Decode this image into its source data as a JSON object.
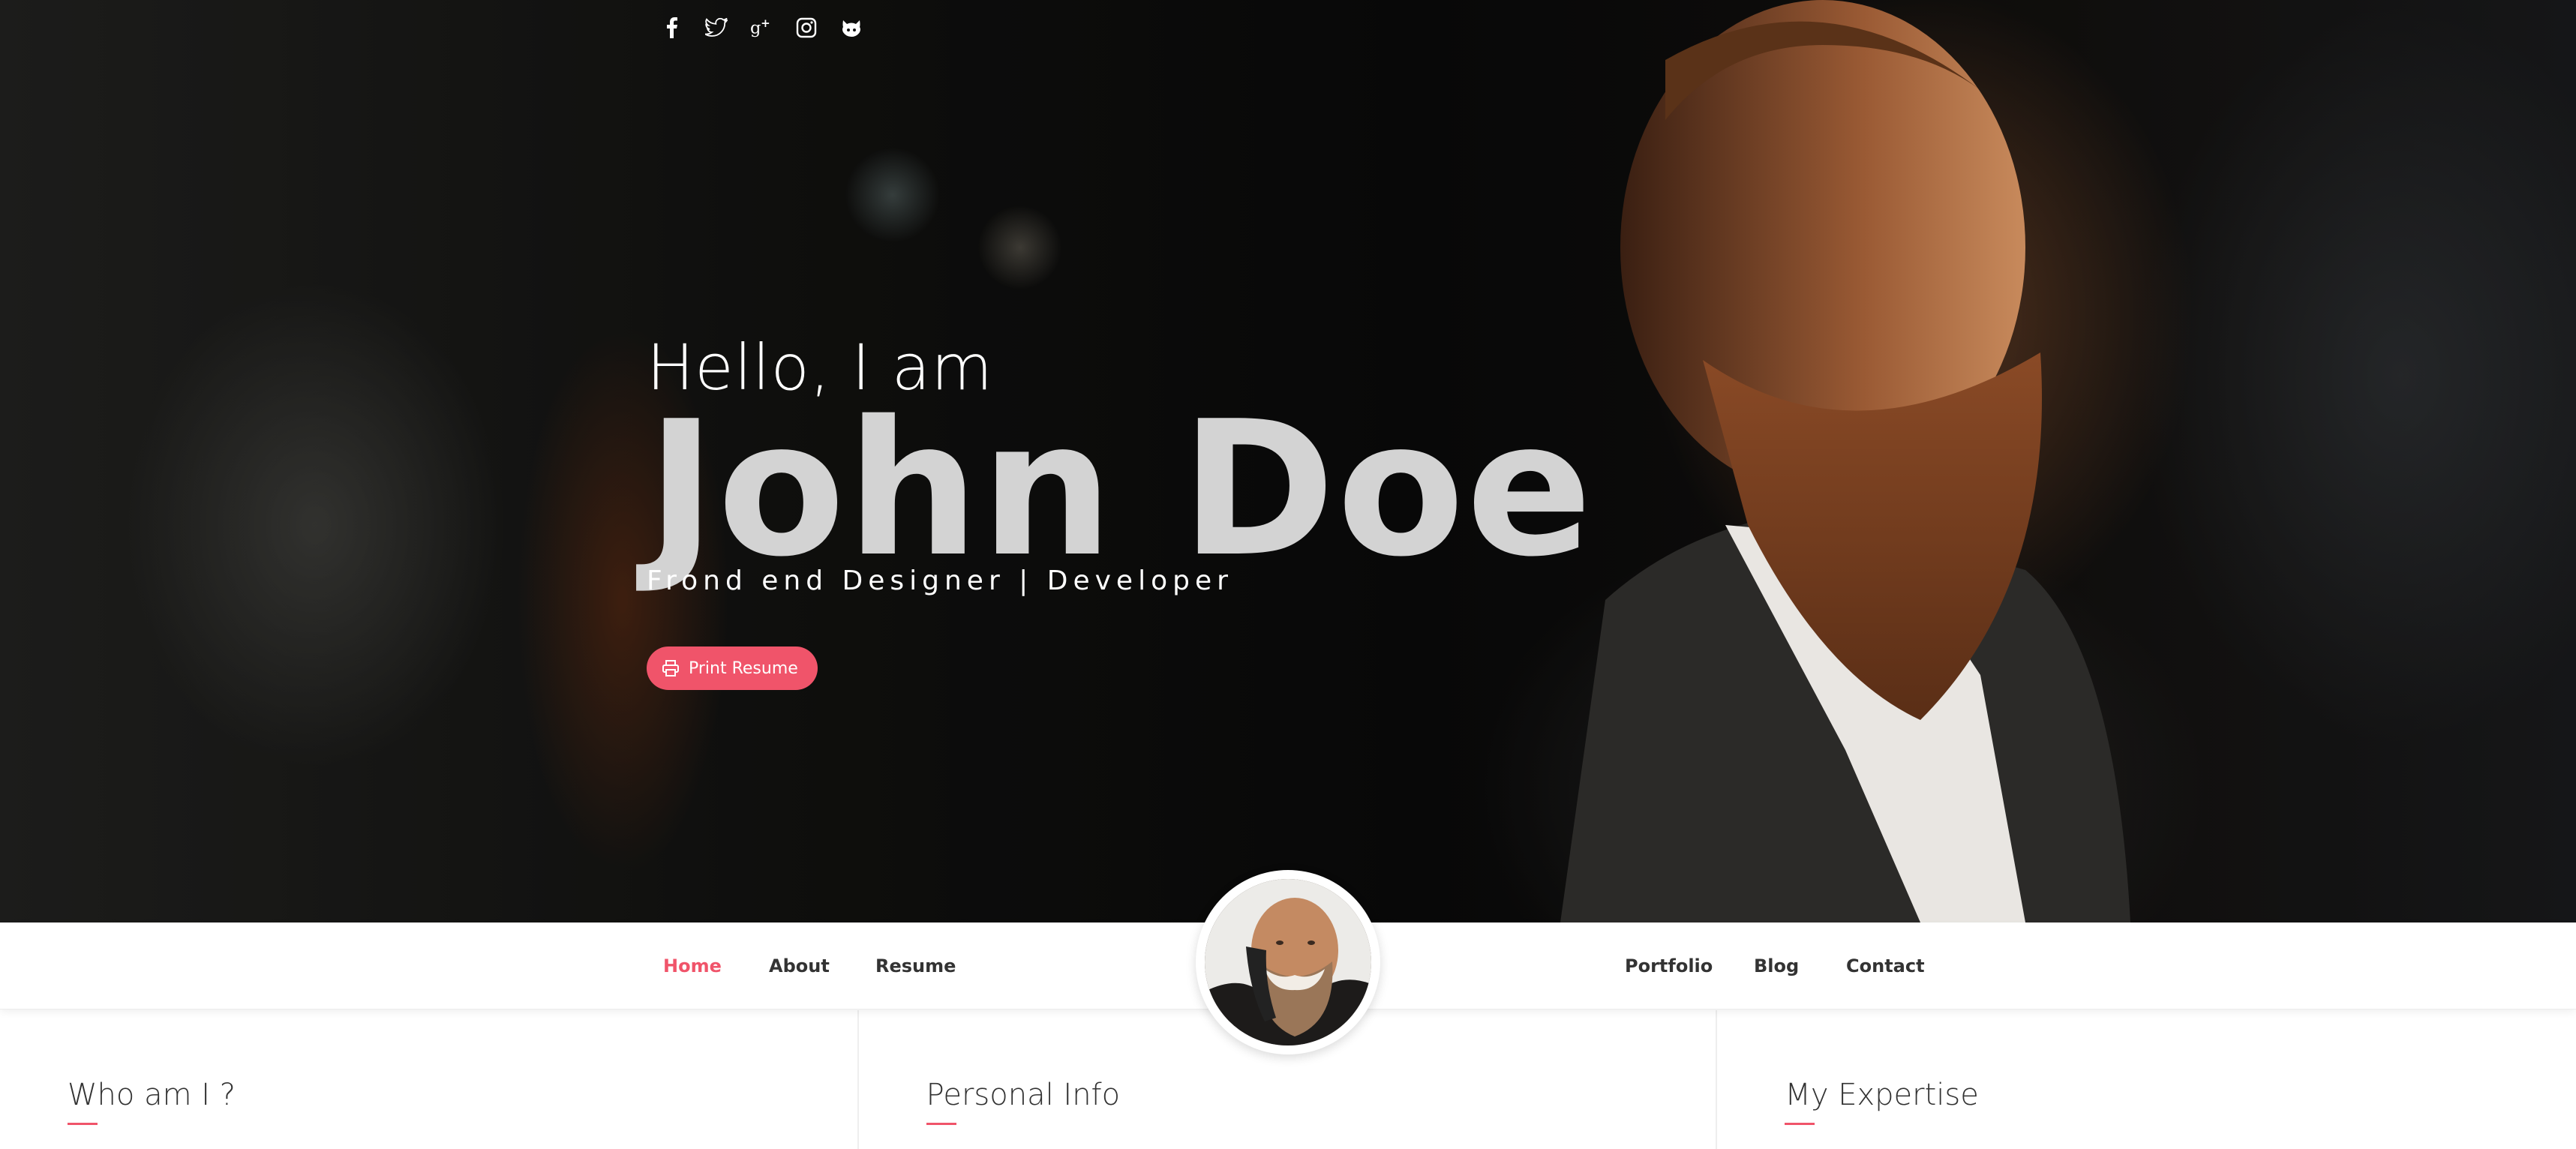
{
  "hero": {
    "greeting": "Hello, I am",
    "name": "John Doe",
    "role": "Frond end Designer | Developer",
    "print_button_label": "Print Resume"
  },
  "social_icons": [
    "facebook-icon",
    "twitter-icon",
    "google-plus-icon",
    "instagram-icon",
    "github-icon"
  ],
  "nav": {
    "left": [
      "Home",
      "About",
      "Resume"
    ],
    "right": [
      "Portfolio",
      "Blog",
      "Contact"
    ],
    "active": "Home"
  },
  "sections": {
    "who": "Who am I ?",
    "personal": "Personal Info",
    "expertise": "My Expertise"
  },
  "colors": {
    "accent": "#f0546a",
    "name_text": "#d3d3d3",
    "nav_text": "#333333"
  }
}
